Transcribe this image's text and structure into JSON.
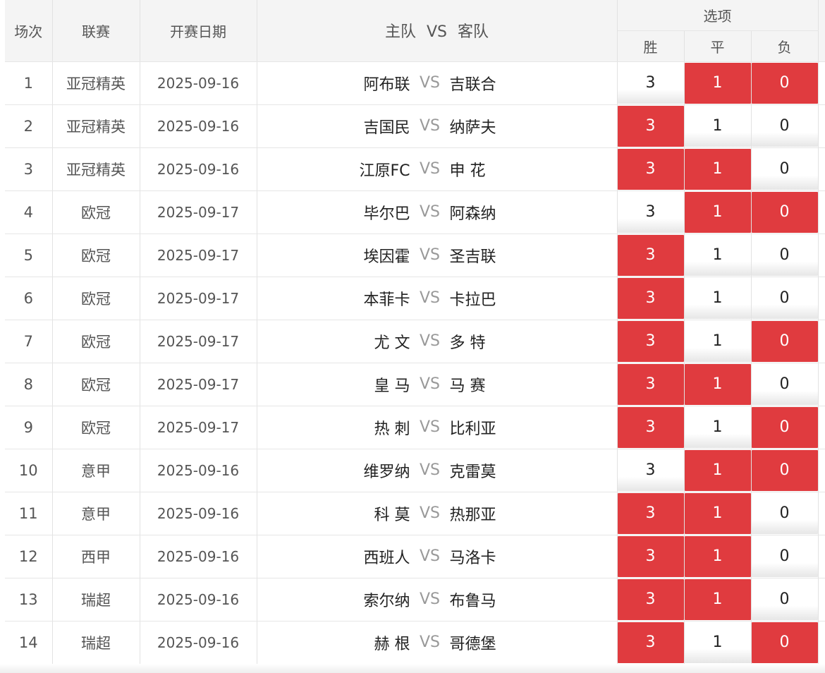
{
  "header": {
    "col_index": "场次",
    "col_league": "联赛",
    "col_date": "开赛日期",
    "col_home": "主队",
    "col_vs": "VS",
    "col_away": "客队",
    "options_title": "选项",
    "opt_win": "胜",
    "opt_draw": "平",
    "opt_loss": "负"
  },
  "rows": [
    {
      "no": "1",
      "league": "亚冠精英",
      "date": "2025-09-16",
      "home": "阿布联",
      "vs": "VS",
      "away": "吉联合",
      "win": "3",
      "draw": "1",
      "loss": "0",
      "sel_win": false,
      "sel_draw": true,
      "sel_loss": true
    },
    {
      "no": "2",
      "league": "亚冠精英",
      "date": "2025-09-16",
      "home": "吉国民",
      "vs": "VS",
      "away": "纳萨夫",
      "win": "3",
      "draw": "1",
      "loss": "0",
      "sel_win": true,
      "sel_draw": false,
      "sel_loss": false
    },
    {
      "no": "3",
      "league": "亚冠精英",
      "date": "2025-09-16",
      "home": "江原FC",
      "vs": "VS",
      "away": "申 花",
      "win": "3",
      "draw": "1",
      "loss": "0",
      "sel_win": true,
      "sel_draw": true,
      "sel_loss": false
    },
    {
      "no": "4",
      "league": "欧冠",
      "date": "2025-09-17",
      "home": "毕尔巴",
      "vs": "VS",
      "away": "阿森纳",
      "win": "3",
      "draw": "1",
      "loss": "0",
      "sel_win": false,
      "sel_draw": true,
      "sel_loss": true
    },
    {
      "no": "5",
      "league": "欧冠",
      "date": "2025-09-17",
      "home": "埃因霍",
      "vs": "VS",
      "away": "圣吉联",
      "win": "3",
      "draw": "1",
      "loss": "0",
      "sel_win": true,
      "sel_draw": false,
      "sel_loss": false
    },
    {
      "no": "6",
      "league": "欧冠",
      "date": "2025-09-17",
      "home": "本菲卡",
      "vs": "VS",
      "away": "卡拉巴",
      "win": "3",
      "draw": "1",
      "loss": "0",
      "sel_win": true,
      "sel_draw": false,
      "sel_loss": false
    },
    {
      "no": "7",
      "league": "欧冠",
      "date": "2025-09-17",
      "home": "尤 文",
      "vs": "VS",
      "away": "多 特",
      "win": "3",
      "draw": "1",
      "loss": "0",
      "sel_win": true,
      "sel_draw": false,
      "sel_loss": true
    },
    {
      "no": "8",
      "league": "欧冠",
      "date": "2025-09-17",
      "home": "皇 马",
      "vs": "VS",
      "away": "马 赛",
      "win": "3",
      "draw": "1",
      "loss": "0",
      "sel_win": true,
      "sel_draw": true,
      "sel_loss": false
    },
    {
      "no": "9",
      "league": "欧冠",
      "date": "2025-09-17",
      "home": "热 刺",
      "vs": "VS",
      "away": "比利亚",
      "win": "3",
      "draw": "1",
      "loss": "0",
      "sel_win": true,
      "sel_draw": false,
      "sel_loss": true
    },
    {
      "no": "10",
      "league": "意甲",
      "date": "2025-09-16",
      "home": "维罗纳",
      "vs": "VS",
      "away": "克雷莫",
      "win": "3",
      "draw": "1",
      "loss": "0",
      "sel_win": false,
      "sel_draw": true,
      "sel_loss": true
    },
    {
      "no": "11",
      "league": "意甲",
      "date": "2025-09-16",
      "home": "科 莫",
      "vs": "VS",
      "away": "热那亚",
      "win": "3",
      "draw": "1",
      "loss": "0",
      "sel_win": true,
      "sel_draw": true,
      "sel_loss": false
    },
    {
      "no": "12",
      "league": "西甲",
      "date": "2025-09-16",
      "home": "西班人",
      "vs": "VS",
      "away": "马洛卡",
      "win": "3",
      "draw": "1",
      "loss": "0",
      "sel_win": true,
      "sel_draw": true,
      "sel_loss": false
    },
    {
      "no": "13",
      "league": "瑞超",
      "date": "2025-09-16",
      "home": "索尔纳",
      "vs": "VS",
      "away": "布鲁马",
      "win": "3",
      "draw": "1",
      "loss": "0",
      "sel_win": true,
      "sel_draw": true,
      "sel_loss": false
    },
    {
      "no": "14",
      "league": "瑞超",
      "date": "2025-09-16",
      "home": "赫 根",
      "vs": "VS",
      "away": "哥德堡",
      "win": "3",
      "draw": "1",
      "loss": "0",
      "sel_win": true,
      "sel_draw": false,
      "sel_loss": true
    }
  ],
  "colors": {
    "selected": "#e03b3f",
    "header_bg": "#f4f4f4",
    "border": "#e2e2e2"
  }
}
